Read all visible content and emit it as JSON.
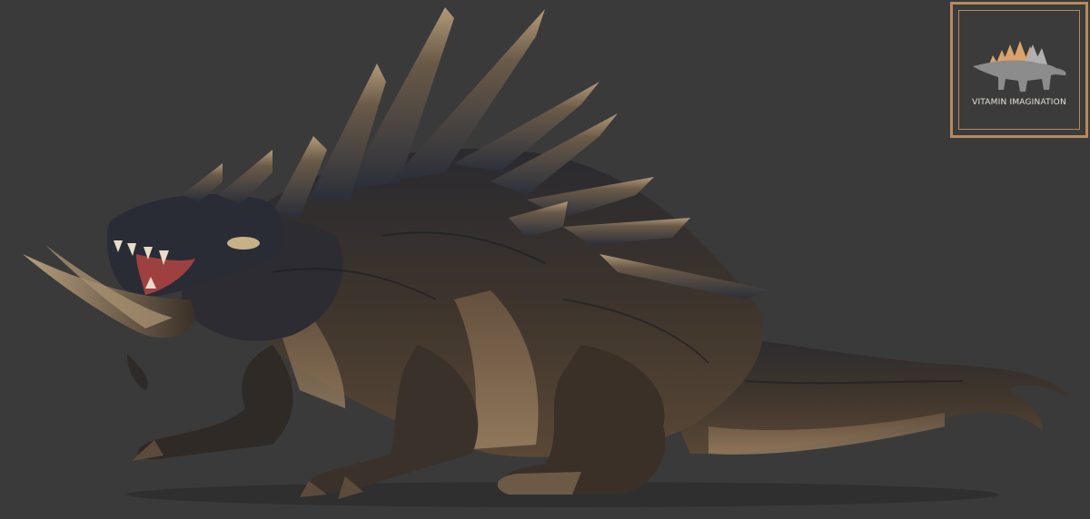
{
  "image": {
    "background_color": "#3a3a3a",
    "subject": "dragon-creature",
    "palette": {
      "dark_scale": "#1f2430",
      "mid_scale": "#4a3f35",
      "light_scale": "#8b7457",
      "horn": "#b69a76",
      "mouth": "#9e4040"
    }
  },
  "watermark": {
    "text": "VITAMIN IMAGINATION",
    "border_color": "#b8895c",
    "icon": "stegosaurus-icon"
  }
}
